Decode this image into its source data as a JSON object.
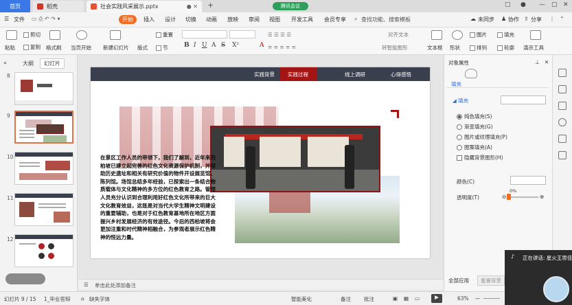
{
  "tabs": {
    "home": "首页",
    "docer": "稻壳",
    "file": "社会实践风采展示.pptx",
    "meeting": "腾讯会议"
  },
  "window": {
    "login": "未同步",
    "collab": "协作",
    "share": "分享"
  },
  "menu": {
    "file": "文件",
    "start": "开始",
    "items": [
      "插入",
      "设计",
      "切换",
      "动画",
      "放映",
      "审阅",
      "视图",
      "开发工具",
      "会员专享"
    ],
    "search": "查找功能、搜索模板"
  },
  "ribbon": {
    "paste": "粘贴",
    "cut": "剪切",
    "copy": "复制",
    "format_painter": "格式刷",
    "from_current": "当页开始",
    "new_slide": "新建幻灯片",
    "layout": "版式",
    "section": "节",
    "reset": "重置",
    "text_box": "文本框",
    "shape": "形状",
    "arrange": "排列",
    "picture": "图片",
    "fill": "填充",
    "outline": "轮廓",
    "presentation_tools": "演示工具",
    "convert_to_smartart": "转智能图形",
    "text_direction": "对齐文本"
  },
  "left_panel": {
    "tab_outline": "大纲",
    "tab_slides": "幻灯片",
    "slide_numbers": [
      "8",
      "9",
      "10",
      "11",
      "12"
    ]
  },
  "slide": {
    "nav": [
      "实践背景",
      "实践过程",
      "线上调研",
      "心得感悟"
    ],
    "active_nav": 1,
    "body": "在景区工作人员的带领下，我们了解到，近年来西柏坡已建立起完善的红色文化资源保护机制，并借助历史遗址和相关有研究价值的物件开设展览馆、陈列馆。场馆总结多年经验，已探索出一条结合物质载体与文化精神的多方位的红色教育之路。管理人员充分认识到合理利用好红色文化所带来的巨大文化教育效益，这既是对当代大学生精神文明建设的重要辅助，也是对于红色教育基地所在地区方面振兴乡村发展经济的有效途径。今后的西柏坡将会更加注重和时代精神相融合，为参观者展示红色精神的恒远力量。"
  },
  "notes_placeholder": "单击此处添加备注",
  "right_pane": {
    "title": "对象属性",
    "tab_fill": "填充",
    "section_fill": "填充",
    "options": [
      "纯色填充(S)",
      "渐变填充(G)",
      "图片或纹理填充(P)",
      "图案填充(A)"
    ],
    "selected_option": 0,
    "hide_bg": "隐藏背景图形(H)",
    "color_label": "颜色(C)",
    "transparency_label": "透明度(T)",
    "transparency_value": "0%",
    "transparency_fraction": 0,
    "apply_all": "全部应用",
    "reset_bg": "重置背景"
  },
  "speaking": {
    "text": "正在讲话: 星火王思佳"
  },
  "status": {
    "slide_count": "幻灯片 9 / 15",
    "theme": "1_毕业答辩",
    "missing_font": "缺失字体",
    "smart_beautify": "智能美化",
    "notes": "备注",
    "comments": "批注",
    "zoom": "63%"
  }
}
